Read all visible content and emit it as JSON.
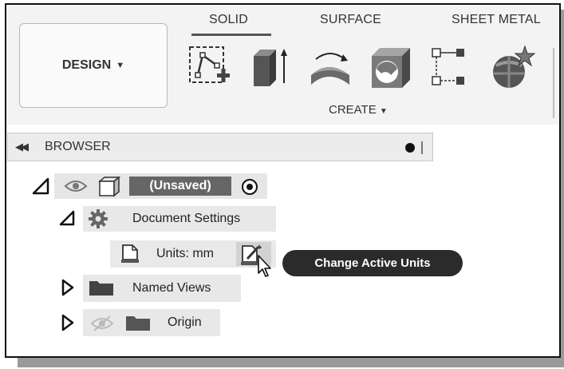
{
  "toolbar": {
    "design_label": "DESIGN",
    "tabs": [
      "SOLID",
      "SURFACE",
      "SHEET METAL"
    ],
    "active_tab": "SOLID",
    "create_label": "CREATE",
    "tools": [
      "create-sketch-icon",
      "extrude-icon",
      "revolve-icon",
      "hole-icon",
      "pattern-icon",
      "insert-icon"
    ]
  },
  "browser": {
    "title": "BROWSER",
    "root": {
      "label": "(Unsaved)"
    },
    "items": [
      {
        "label": "Document Settings",
        "icon": "gear-icon"
      },
      {
        "label": "Units: mm",
        "icon": "document-icon"
      },
      {
        "label": "Named Views",
        "icon": "folder-icon"
      },
      {
        "label": "Origin",
        "icon": "folder-icon"
      }
    ]
  },
  "tooltip": {
    "text": "Change Active Units"
  },
  "colors": {
    "toolbar_bg": "#f3f3f3",
    "active_item_bg": "#666666",
    "tooltip_bg": "#2b2b2b"
  }
}
